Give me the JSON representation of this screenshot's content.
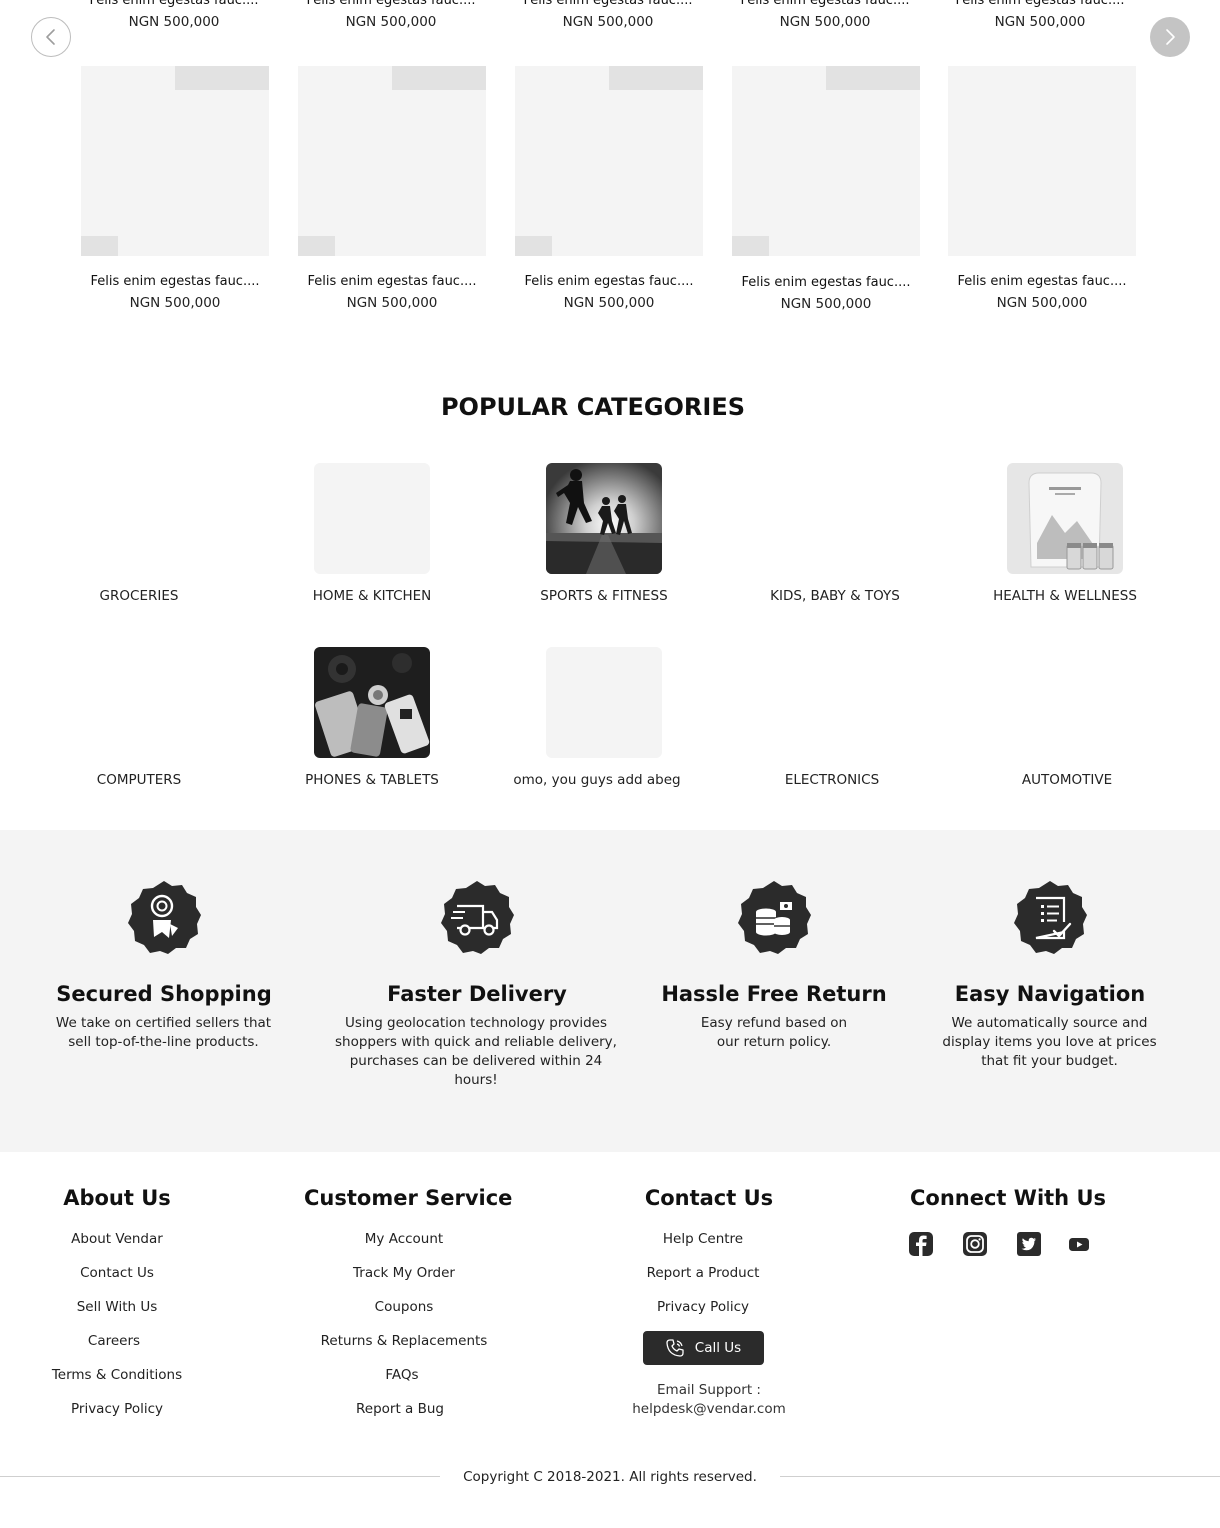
{
  "carousel": {
    "prev_icon": "chevron-left-icon",
    "next_icon": "chevron-right-icon",
    "top_row": [
      {
        "name": "Felis enim egestas fauc....",
        "price": "NGN 500,000"
      },
      {
        "name": "Felis enim egestas fauc....",
        "price": "NGN 500,000"
      },
      {
        "name": "Felis enim egestas fauc....",
        "price": "NGN 500,000"
      },
      {
        "name": "Felis enim egestas fauc....",
        "price": "NGN 500,000"
      },
      {
        "name": "Felis enim egestas fauc....",
        "price": "NGN 500,000"
      }
    ],
    "products": [
      {
        "name": "Felis enim egestas fauc....",
        "price": "NGN 500,000"
      },
      {
        "name": "Felis enim egestas fauc....",
        "price": "NGN 500,000"
      },
      {
        "name": "Felis enim egestas fauc....",
        "price": "NGN 500,000"
      },
      {
        "name": "Felis enim egestas fauc....",
        "price": "NGN 500,000"
      },
      {
        "name": "Felis enim egestas fauc....",
        "price": "NGN 500,000"
      }
    ]
  },
  "categories": {
    "title": "POPULAR CATEGORIES",
    "items": [
      {
        "label": "GROCERIES"
      },
      {
        "label": "HOME & KITCHEN"
      },
      {
        "label": "SPORTS & FITNESS"
      },
      {
        "label": "KIDS, BABY & TOYS"
      },
      {
        "label": "HEALTH & WELLNESS"
      },
      {
        "label": "COMPUTERS"
      },
      {
        "label": "PHONES & TABLETS"
      },
      {
        "label": "omo, you guys add abeg"
      },
      {
        "label": "ELECTRONICS"
      },
      {
        "label": "AUTOMOTIVE"
      }
    ]
  },
  "features": [
    {
      "icon": "award-ribbon-icon",
      "title": "Secured Shopping",
      "text": "We take on certified sellers that sell top-of-the-line products."
    },
    {
      "icon": "delivery-truck-icon",
      "title": "Faster Delivery",
      "text": "Using geolocation technology provides shoppers with quick and reliable delivery, purchases can be delivered within 24 hours!"
    },
    {
      "icon": "money-coins-icon",
      "title": "Hassle Free Return",
      "text": "Easy refund based on our return policy."
    },
    {
      "icon": "checklist-icon",
      "title": "Easy Navigation",
      "text": "We automatically source and display items you love at prices that fit your budget."
    }
  ],
  "footer": {
    "about": {
      "title": "About Us",
      "links": [
        "About Vendar",
        "Contact Us",
        "Sell With Us",
        "Careers",
        "Terms & Conditions",
        "Privacy Policy"
      ]
    },
    "service": {
      "title": "Customer Service",
      "links": [
        "My Account",
        "Track My Order",
        "Coupons",
        "Returns & Replacements",
        "FAQs",
        "Report a Bug"
      ]
    },
    "contact": {
      "title": "Contact Us",
      "links": [
        "Help Centre",
        "Report a Product",
        "Privacy Policy"
      ],
      "call_label": "Call Us",
      "email_label": "Email Support :",
      "email": "helpdesk@vendar.com"
    },
    "connect": {
      "title": "Connect With Us",
      "socials": [
        "facebook-icon",
        "instagram-icon",
        "twitter-icon",
        "youtube-icon"
      ]
    },
    "copyright": "Copyright C 2018-2021. All rights reserved."
  },
  "colors": {
    "background": "#ffffff",
    "section_gray": "#f4f4f4",
    "badge_dark": "#2b2b2b",
    "button_dark": "#2b2b2b"
  }
}
